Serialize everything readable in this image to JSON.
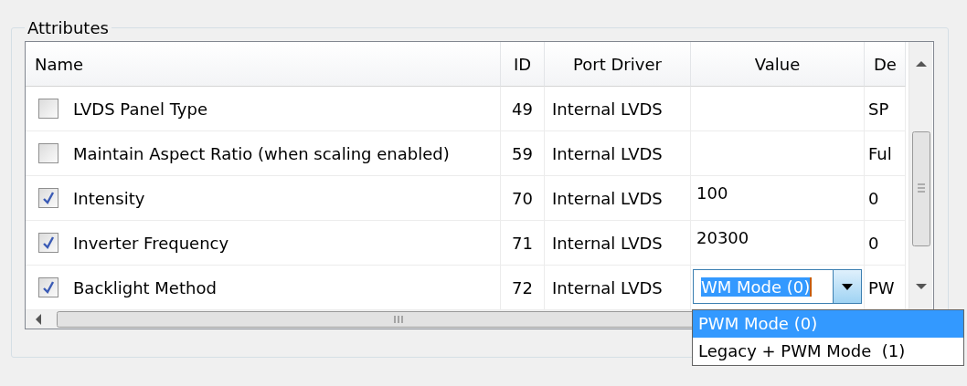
{
  "group": {
    "title": "Attributes"
  },
  "table": {
    "columns": [
      "Name",
      "ID",
      "Port Driver",
      "Value",
      "De"
    ],
    "rows": [
      {
        "checked": false,
        "name": "LVDS Panel Type",
        "id": "49",
        "port_driver": "Internal LVDS",
        "value": {
          "kind": "empty"
        },
        "default": "SP"
      },
      {
        "checked": false,
        "name": "Maintain Aspect Ratio (when scaling enabled)",
        "id": "59",
        "port_driver": "Internal LVDS",
        "value": {
          "kind": "empty"
        },
        "default": "Ful"
      },
      {
        "checked": true,
        "name": "Intensity",
        "id": "70",
        "port_driver": "Internal LVDS",
        "value": {
          "kind": "text",
          "text": "100"
        },
        "default": "0"
      },
      {
        "checked": true,
        "name": "Inverter Frequency",
        "id": "71",
        "port_driver": "Internal LVDS",
        "value": {
          "kind": "text",
          "text": "20300"
        },
        "default": "0"
      },
      {
        "checked": true,
        "name": "Backlight Method",
        "id": "72",
        "port_driver": "Internal LVDS",
        "value": {
          "kind": "combo",
          "text": "WM Mode (0)",
          "expanded": true
        },
        "default": "PW"
      }
    ]
  },
  "dropdown": {
    "options": [
      {
        "label": "PWM Mode (0)",
        "selected": true
      },
      {
        "label": "Legacy + PWM Mode  (1)",
        "selected": false
      }
    ]
  }
}
